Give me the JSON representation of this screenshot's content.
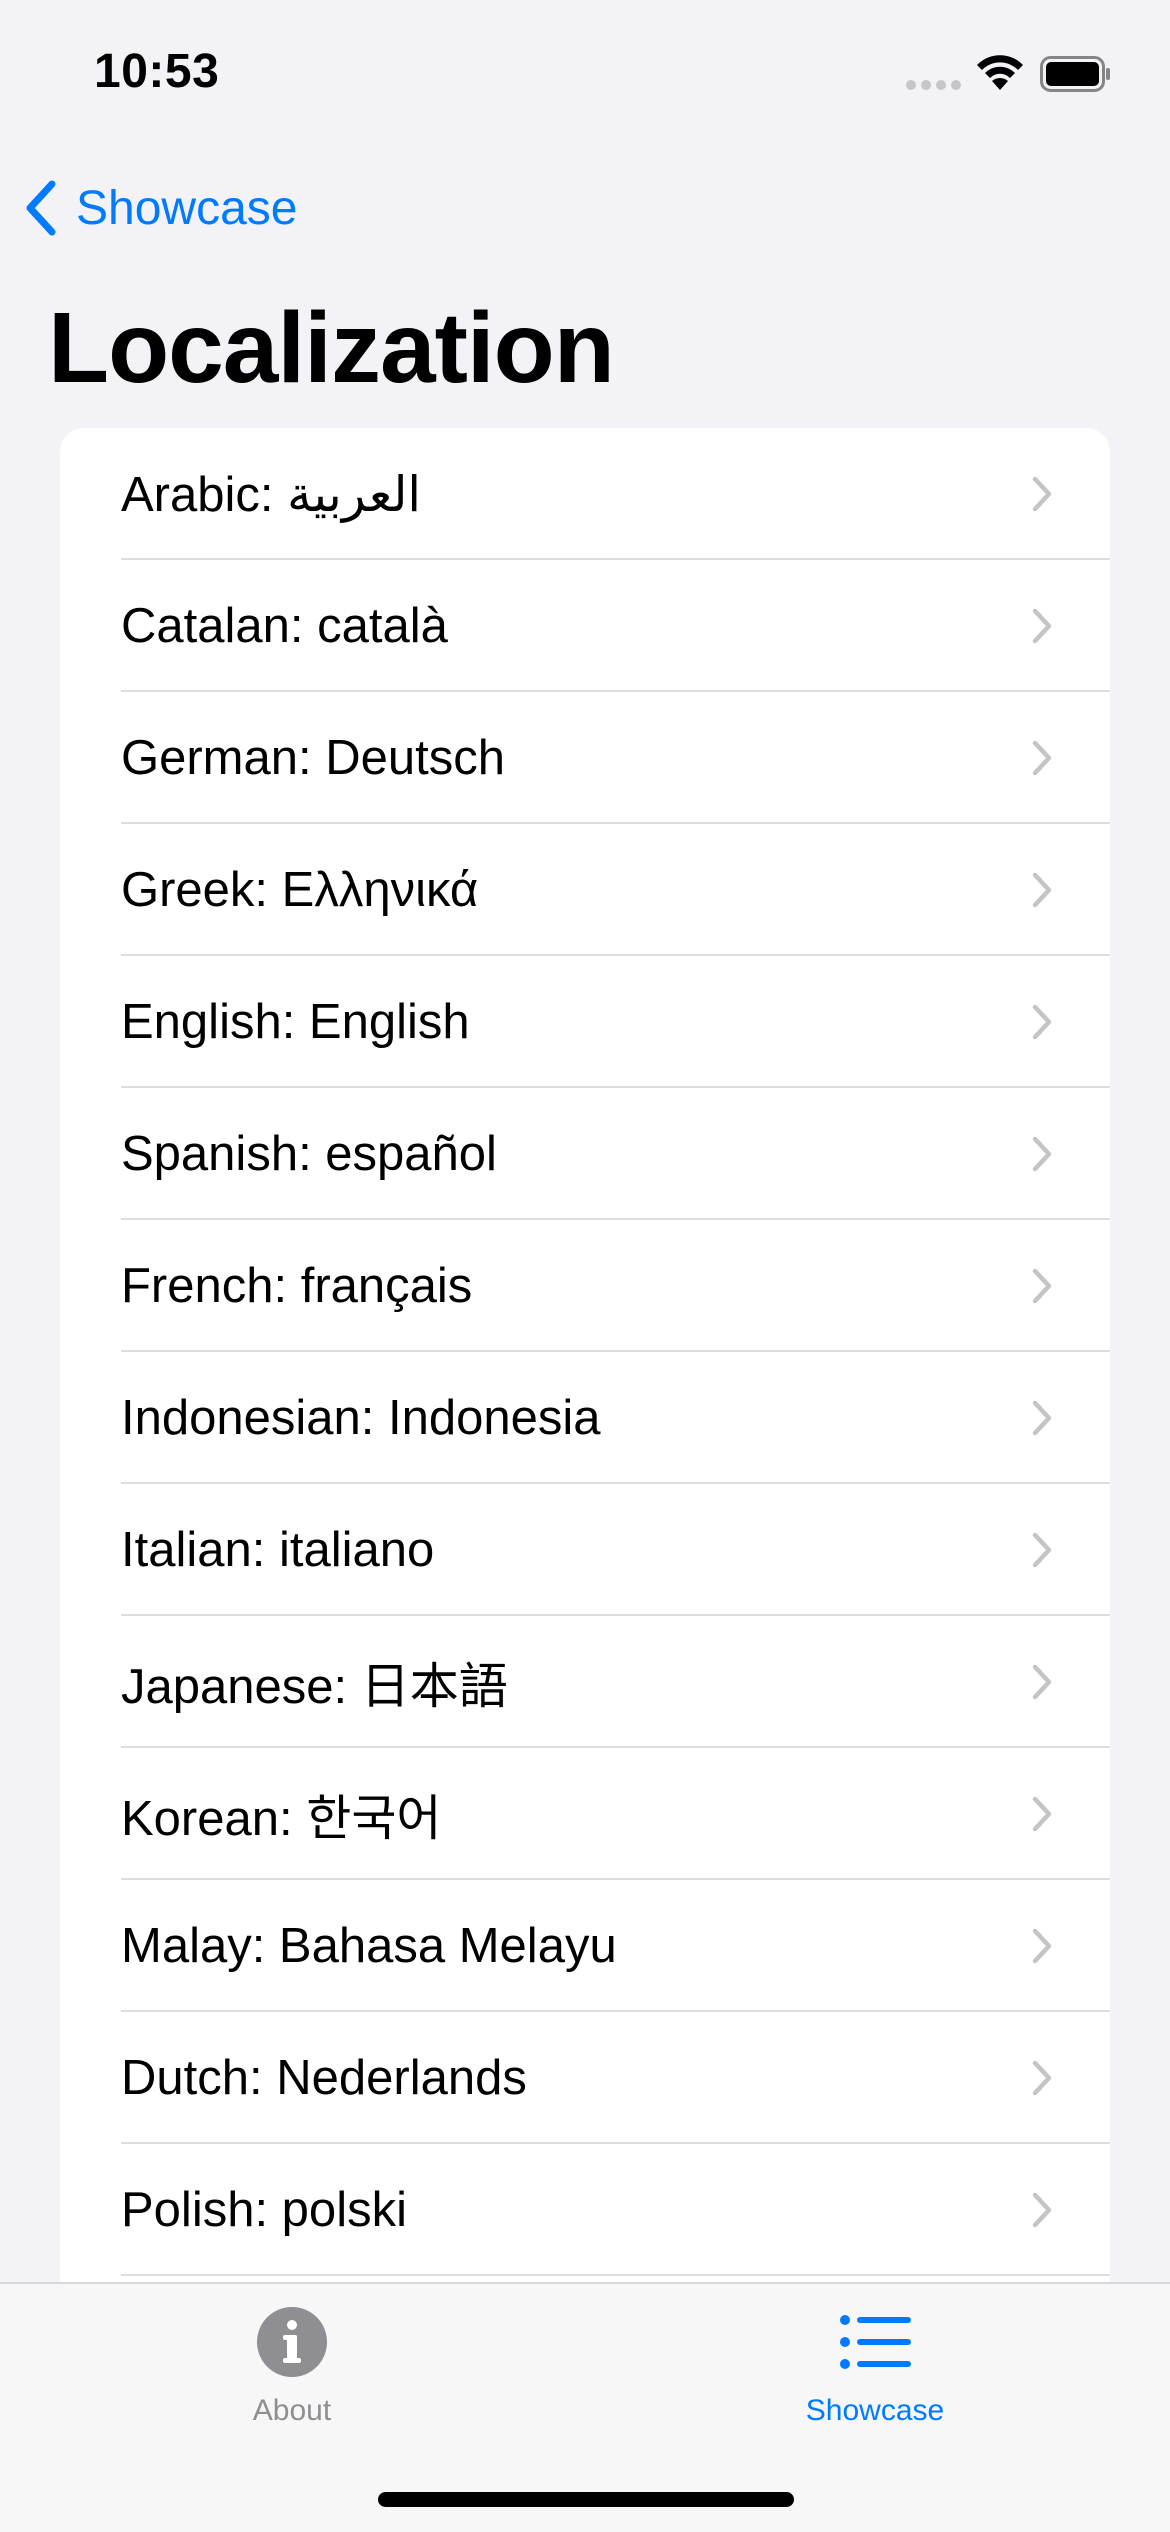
{
  "status_bar": {
    "time": "10:53",
    "icons": [
      "signal-dots-icon",
      "wifi-icon",
      "battery-icon"
    ]
  },
  "nav": {
    "back_label": "Showcase",
    "title": "Localization"
  },
  "languages": [
    {
      "label": "Arabic: العربية"
    },
    {
      "label": "Catalan: català"
    },
    {
      "label": "German: Deutsch"
    },
    {
      "label": "Greek: Ελληνικά"
    },
    {
      "label": "English: English"
    },
    {
      "label": "Spanish: español"
    },
    {
      "label": "French: français"
    },
    {
      "label": "Indonesian: Indonesia"
    },
    {
      "label": "Italian: italiano"
    },
    {
      "label": "Japanese: 日本語"
    },
    {
      "label": "Korean: 한국어"
    },
    {
      "label": "Malay: Bahasa Melayu"
    },
    {
      "label": "Dutch: Nederlands"
    },
    {
      "label": "Polish: polski"
    }
  ],
  "tab_bar": {
    "tabs": [
      {
        "label": "About",
        "icon": "info-circle-icon",
        "selected": false
      },
      {
        "label": "Showcase",
        "icon": "list-bullet-icon",
        "selected": true
      }
    ]
  },
  "colors": {
    "accent": "#007AFF",
    "background": "#F2F2F7",
    "inactive_tab": "#8E8E93"
  }
}
